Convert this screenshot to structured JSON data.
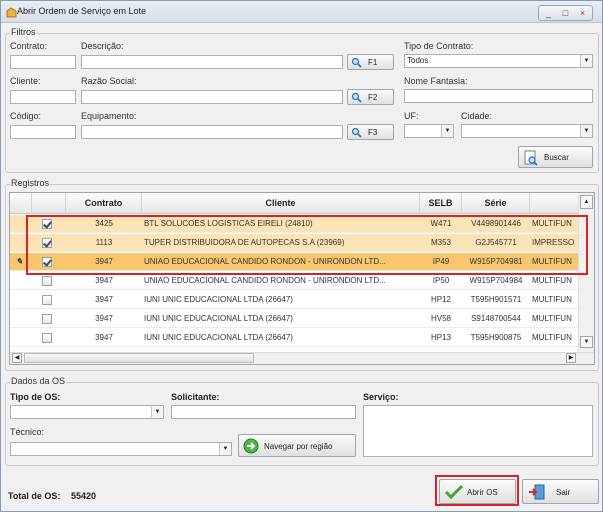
{
  "window": {
    "title": "Abrir Ordem de Serviço em Lote",
    "min_glyph": "_",
    "max_glyph": "□",
    "close_glyph": "×"
  },
  "filtros": {
    "title": "Filtros",
    "contrato_label": "Contrato:",
    "descricao_label": "Descrição:",
    "tipo_contrato_label": "Tipo de Contrato:",
    "tipo_contrato_value": "Todos",
    "f1_label": "F1",
    "cliente_label": "Cliente:",
    "razao_social_label": "Razão Social:",
    "nome_fantasia_label": "Nome Fantasia:",
    "f2_label": "F2",
    "codigo_label": "Código:",
    "equipamento_label": "Equipamento:",
    "uf_label": "UF:",
    "cidade_label": "Cidade:",
    "f3_label": "F3",
    "buscar_label": "Buscar"
  },
  "registros": {
    "title": "Registros",
    "columns": [
      "Contrato",
      "Cliente",
      "SELB",
      "Série"
    ],
    "rows": [
      {
        "checked": true,
        "contrato": "3425",
        "cliente": "BTL SOLUCOES LOGISTICAS EIRELI (24810)",
        "selb": "W471",
        "serie": "V4498901446",
        "extra": "MULTIFUN"
      },
      {
        "checked": true,
        "contrato": "1113",
        "cliente": "TUPER DISTRIBUIDORA DE AUTOPECAS S.A (23969)",
        "selb": "M353",
        "serie": "G2J545771",
        "extra": "IMPRESSO"
      },
      {
        "checked": true,
        "current": true,
        "contrato": "3947",
        "cliente": "UNIAO EDUCACIONAL CANDIDO RONDON - UNIRONDON LTD...",
        "selb": "IP49",
        "serie": "W915P704981",
        "extra": "MULTIFUN"
      },
      {
        "checked": false,
        "contrato": "3947",
        "cliente": "UNIAO EDUCACIONAL CANDIDO RONDON - UNIRONDON LTD...",
        "selb": "IP50",
        "serie": "W915P704984",
        "extra": "MULTIFUN"
      },
      {
        "checked": false,
        "contrato": "3947",
        "cliente": "IUNI UNIC EDUCACIONAL LTDA (26647)",
        "selb": "HP12",
        "serie": "T595H901571",
        "extra": "MULTIFUN"
      },
      {
        "checked": false,
        "contrato": "3947",
        "cliente": "IUNI UNIC EDUCACIONAL LTDA (26647)",
        "selb": "HV58",
        "serie": "S9148700544",
        "extra": "MULTIFUN"
      },
      {
        "checked": false,
        "contrato": "3947",
        "cliente": "IUNI UNIC EDUCACIONAL LTDA (26647)",
        "selb": "HP13",
        "serie": "T595H900875",
        "extra": "MULTIFUN"
      }
    ]
  },
  "dados": {
    "title": "Dados da OS",
    "tipo_os_label": "Tipo de OS:",
    "solicitante_label": "Solicitante:",
    "servico_label": "Serviço:",
    "tecnico_label": "Técnico:",
    "navegar_label": "Navegar por região"
  },
  "footer": {
    "total_label": "Total de OS:",
    "total_value": "55420",
    "abrir_label": "Abrir OS",
    "sair_label": "Sair"
  },
  "colors": {
    "highlight": "#fce3b6",
    "current_row": "#f9c66e",
    "red": "#d1242b"
  }
}
